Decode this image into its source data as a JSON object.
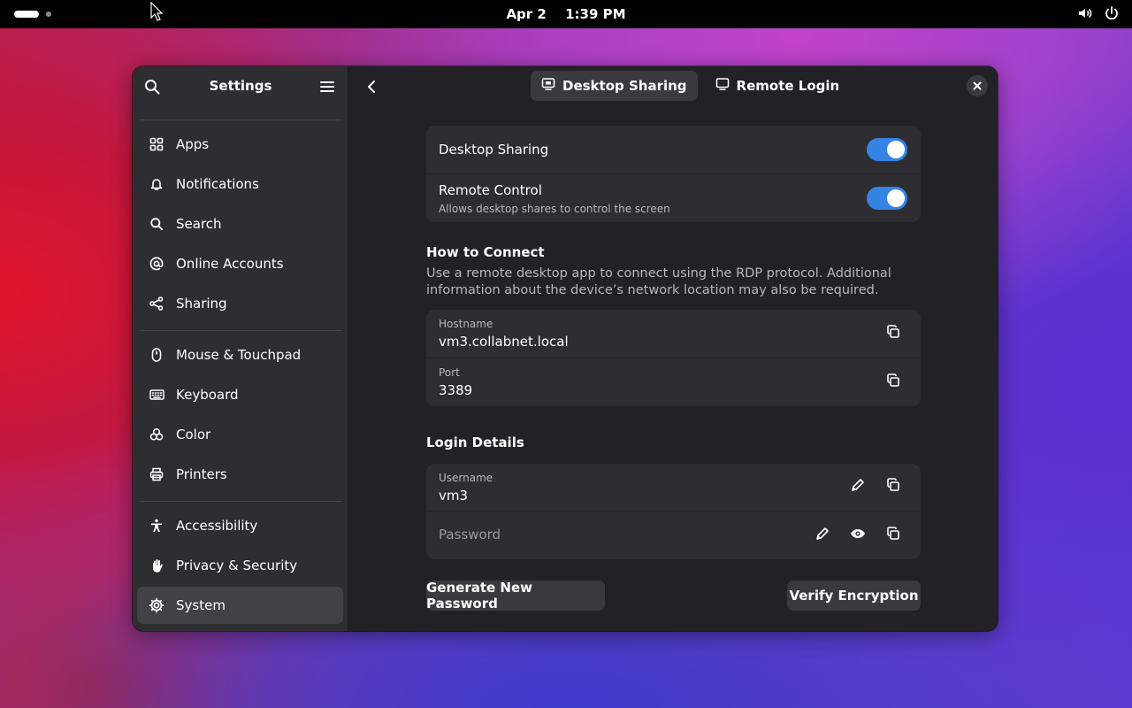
{
  "topbar": {
    "date": "Apr 2",
    "time": "1:39 PM",
    "icons": [
      "volume-icon",
      "power-icon"
    ]
  },
  "sidebar": {
    "title": "Settings",
    "items": [
      {
        "label": "Apps",
        "icon": "apps-grid-icon"
      },
      {
        "label": "Notifications",
        "icon": "bell-icon"
      },
      {
        "label": "Search",
        "icon": "search-icon"
      },
      {
        "label": "Online Accounts",
        "icon": "at-sign-icon"
      },
      {
        "label": "Sharing",
        "icon": "share-icon"
      },
      {
        "label": "Mouse & Touchpad",
        "icon": "mouse-icon"
      },
      {
        "label": "Keyboard",
        "icon": "keyboard-icon"
      },
      {
        "label": "Color",
        "icon": "color-circles-icon"
      },
      {
        "label": "Printers",
        "icon": "printer-icon"
      },
      {
        "label": "Accessibility",
        "icon": "accessibility-person-icon"
      },
      {
        "label": "Privacy & Security",
        "icon": "hand-icon"
      },
      {
        "label": "System",
        "icon": "gear-icon"
      }
    ],
    "active": "System"
  },
  "header": {
    "tabs": [
      {
        "label": "Desktop Sharing",
        "active": true
      },
      {
        "label": "Remote Login",
        "active": false
      }
    ]
  },
  "sharing": {
    "desktop_sharing": {
      "label": "Desktop Sharing",
      "enabled": true
    },
    "remote_control": {
      "label": "Remote Control",
      "subtitle": "Allows desktop shares to control the screen",
      "enabled": true
    }
  },
  "connect": {
    "heading": "How to Connect",
    "description": "Use a remote desktop app to connect using the RDP protocol. Additional information about the device’s network location may also be required.",
    "hostname_label": "Hostname",
    "hostname": "vm3.collabnet.local",
    "port_label": "Port",
    "port": "3389"
  },
  "login": {
    "heading": "Login Details",
    "username_label": "Username",
    "username": "vm3",
    "password_placeholder": "Password"
  },
  "buttons": {
    "generate": "Generate New Password",
    "verify": "Verify Encryption"
  },
  "colors": {
    "accent": "#3584e4",
    "window_bg": "#222226",
    "sidebar_bg": "#2e2e32",
    "card_bg": "#2e2e32"
  }
}
